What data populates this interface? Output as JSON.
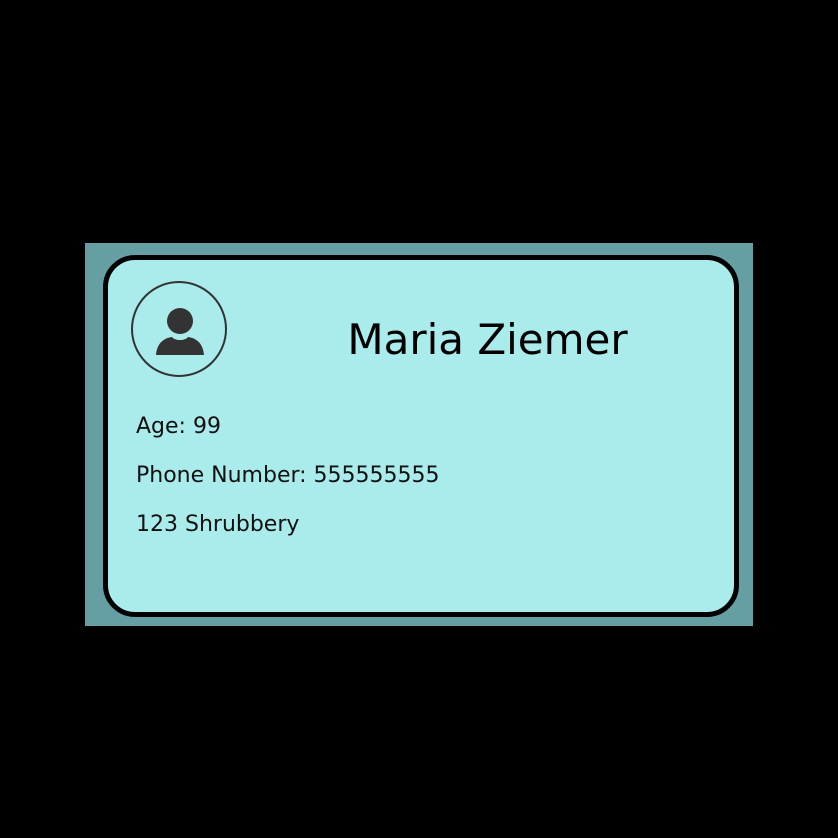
{
  "contact_card": {
    "name": "Maria Ziemer",
    "age": "Age: 99",
    "phone": "Phone Number: 555555555",
    "address": "123 Shrubbery",
    "avatar_icon": "user-icon"
  },
  "colors": {
    "background": "#000000",
    "frame": "#669fa3",
    "card": "#aaebeb",
    "card_border": "#000000",
    "icon": "#333333"
  }
}
